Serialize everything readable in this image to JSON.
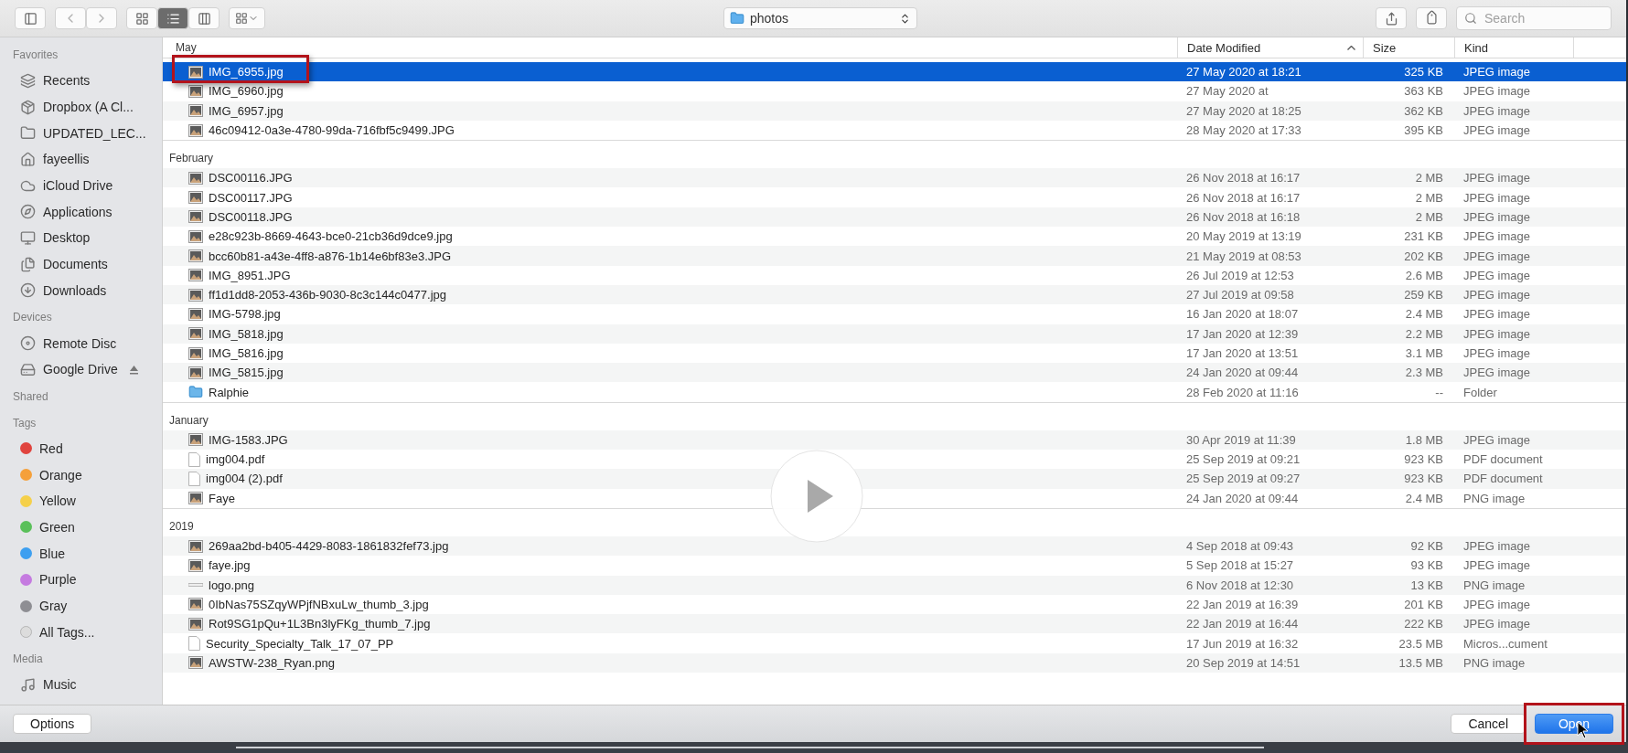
{
  "toolbar": {
    "view_modes": [
      {
        "kind": "icons",
        "selected": false
      },
      {
        "kind": "list",
        "selected": true
      },
      {
        "kind": "columns",
        "selected": false
      }
    ],
    "location": "photos",
    "search": {
      "placeholder": "Search"
    }
  },
  "sidebar": {
    "sections": [
      {
        "title": "Favorites",
        "items": [
          {
            "label": "Recents",
            "kind": "recents"
          },
          {
            "label": "Dropbox (A Cl...",
            "kind": "dropbox"
          },
          {
            "label": "UPDATED_LEC...",
            "kind": "folder"
          },
          {
            "label": "fayeellis",
            "kind": "home"
          },
          {
            "label": "iCloud Drive",
            "kind": "cloud"
          },
          {
            "label": "Applications",
            "kind": "apps"
          },
          {
            "label": "Desktop",
            "kind": "desktop"
          },
          {
            "label": "Documents",
            "kind": "documents"
          },
          {
            "label": "Downloads",
            "kind": "downloads"
          }
        ]
      },
      {
        "title": "Devices",
        "items": [
          {
            "label": "Remote Disc",
            "kind": "disc"
          },
          {
            "label": "Google Drive",
            "kind": "drive"
          }
        ]
      },
      {
        "title": "Shared"
      },
      {
        "title": "Tags",
        "items": [
          {
            "label": "Red",
            "kind": "tag",
            "color": "#e0443e"
          },
          {
            "label": "Orange",
            "kind": "tag",
            "color": "#f5a03a"
          },
          {
            "label": "Yellow",
            "kind": "tag",
            "color": "#f5d04a"
          },
          {
            "label": "Green",
            "kind": "tag",
            "color": "#5ac05a"
          },
          {
            "label": "Blue",
            "kind": "tag",
            "color": "#3d9ff0"
          },
          {
            "label": "Purple",
            "kind": "tag",
            "color": "#c57be0"
          },
          {
            "label": "Gray",
            "kind": "tag",
            "color": "#8e8e93"
          },
          {
            "label": "All Tags...",
            "kind": "all-tags"
          }
        ]
      },
      {
        "title": "Media",
        "items": [
          {
            "label": "Music",
            "kind": "music"
          }
        ]
      }
    ]
  },
  "table": {
    "columns": [
      {
        "label": "Date Modified",
        "sorted": true
      },
      {
        "label": "Size",
        "sorted": false
      },
      {
        "label": "Kind",
        "sorted": false
      }
    ],
    "groups": [
      {
        "title": "May",
        "rows": [
          {
            "name": "IMG_6955.jpg",
            "date": "27 May 2020 at 18:21",
            "size": "325 KB",
            "type": "JPEG image",
            "kind": "photo",
            "selected": true,
            "highlighted": true
          },
          {
            "name": "IMG_6960.jpg",
            "date": "27 May 2020 at",
            "size": "363 KB",
            "type": "JPEG image",
            "kind": "photo",
            "selected": false,
            "highlighted": false
          },
          {
            "name": "IMG_6957.jpg",
            "date": "27 May 2020 at 18:25",
            "size": "362 KB",
            "type": "JPEG image",
            "kind": "photo",
            "selected": false,
            "highlighted": false
          },
          {
            "name": "46c09412-0a3e-4780-99da-716fbf5c9499.JPG",
            "date": "28 May 2020 at 17:33",
            "size": "395 KB",
            "type": "JPEG image",
            "kind": "photo",
            "selected": false,
            "highlighted": false
          }
        ]
      },
      {
        "title": "February",
        "rows": [
          {
            "name": "DSC00116.JPG",
            "date": "26 Nov 2018 at 16:17",
            "size": "2 MB",
            "type": "JPEG image",
            "kind": "photo",
            "selected": false,
            "highlighted": false
          },
          {
            "name": "DSC00117.JPG",
            "date": "26 Nov 2018 at 16:17",
            "size": "2 MB",
            "type": "JPEG image",
            "kind": "photo",
            "selected": false,
            "highlighted": false
          },
          {
            "name": "DSC00118.JPG",
            "date": "26 Nov 2018 at 16:18",
            "size": "2 MB",
            "type": "JPEG image",
            "kind": "photo",
            "selected": false,
            "highlighted": false
          },
          {
            "name": "e28c923b-8669-4643-bce0-21cb36d9dce9.jpg",
            "date": "20 May 2019 at 13:19",
            "size": "231 KB",
            "type": "JPEG image",
            "kind": "photo",
            "selected": false,
            "highlighted": false
          },
          {
            "name": "bcc60b81-a43e-4ff8-a876-1b14e6bf83e3.JPG",
            "date": "21 May 2019 at 08:53",
            "size": "202 KB",
            "type": "JPEG image",
            "kind": "photo",
            "selected": false,
            "highlighted": false
          },
          {
            "name": "IMG_8951.JPG",
            "date": "26 Jul 2019 at 12:53",
            "size": "2.6 MB",
            "type": "JPEG image",
            "kind": "photo",
            "selected": false,
            "highlighted": false
          },
          {
            "name": "ff1d1dd8-2053-436b-9030-8c3c144c0477.jpg",
            "date": "27 Jul 2019 at 09:58",
            "size": "259 KB",
            "type": "JPEG image",
            "kind": "photo",
            "selected": false,
            "highlighted": false
          },
          {
            "name": "IMG-5798.jpg",
            "date": "16 Jan 2020 at 18:07",
            "size": "2.4 MB",
            "type": "JPEG image",
            "kind": "photo",
            "selected": false,
            "highlighted": false
          },
          {
            "name": "IMG_5818.jpg",
            "date": "17 Jan 2020 at 12:39",
            "size": "2.2 MB",
            "type": "JPEG image",
            "kind": "photo",
            "selected": false,
            "highlighted": false
          },
          {
            "name": "IMG_5816.jpg",
            "date": "17 Jan 2020 at 13:51",
            "size": "3.1 MB",
            "type": "JPEG image",
            "kind": "photo",
            "selected": false,
            "highlighted": false
          },
          {
            "name": "IMG_5815.jpg",
            "date": "24 Jan 2020 at 09:44",
            "size": "2.3 MB",
            "type": "JPEG image",
            "kind": "photo",
            "selected": false,
            "highlighted": false
          },
          {
            "name": "Ralphie",
            "date": "28 Feb 2020 at 11:16",
            "size": "--",
            "type": "Folder",
            "kind": "folder",
            "selected": false,
            "highlighted": false
          }
        ]
      },
      {
        "title": "January",
        "rows": [
          {
            "name": "IMG-1583.JPG",
            "date": "30 Apr 2019 at 11:39",
            "size": "1.8 MB",
            "type": "JPEG image",
            "kind": "photo",
            "selected": false,
            "highlighted": false
          },
          {
            "name": "img004.pdf",
            "date": "25 Sep 2019 at 09:21",
            "size": "923 KB",
            "type": "PDF document",
            "kind": "document",
            "selected": false,
            "highlighted": false
          },
          {
            "name": "img004 (2).pdf",
            "date": "25 Sep 2019 at 09:27",
            "size": "923 KB",
            "type": "PDF document",
            "kind": "document",
            "selected": false,
            "highlighted": false
          },
          {
            "name": "Faye",
            "date": "24 Jan 2020 at 09:44",
            "size": "2.4 MB",
            "type": "PNG image",
            "kind": "photo",
            "selected": false,
            "highlighted": false
          }
        ]
      },
      {
        "title": "2019",
        "rows": [
          {
            "name": "269aa2bd-b405-4429-8083-1861832fef73.jpg",
            "date": "4 Sep 2018 at 09:43",
            "size": "92 KB",
            "type": "JPEG image",
            "kind": "photo",
            "selected": false,
            "highlighted": false
          },
          {
            "name": "faye.jpg",
            "date": "5 Sep 2018 at 15:27",
            "size": "93 KB",
            "type": "JPEG image",
            "kind": "photo",
            "selected": false,
            "highlighted": false
          },
          {
            "name": "logo.png",
            "date": "6 Nov 2018 at 12:30",
            "size": "13 KB",
            "type": "PNG image",
            "kind": "strip",
            "selected": false,
            "highlighted": false
          },
          {
            "name": "0IbNas75SZqyWPjfNBxuLw_thumb_3.jpg",
            "date": "22 Jan 2019 at 16:39",
            "size": "201 KB",
            "type": "JPEG image",
            "kind": "photo",
            "selected": false,
            "highlighted": false
          },
          {
            "name": "Rot9SG1pQu+1L3Bn3lyFKg_thumb_7.jpg",
            "date": "22 Jan 2019 at 16:44",
            "size": "222 KB",
            "type": "JPEG image",
            "kind": "photo",
            "selected": false,
            "highlighted": false
          },
          {
            "name": "Security_Specialty_Talk_17_07_PP",
            "date": "17 Jun 2019 at 16:32",
            "size": "23.5 MB",
            "type": "Micros...cument",
            "kind": "document",
            "selected": false,
            "highlighted": false
          },
          {
            "name": "AWSTW-238_Ryan.png",
            "date": "20 Sep 2019 at 14:51",
            "size": "13.5 MB",
            "type": "PNG image",
            "kind": "photo",
            "selected": false,
            "highlighted": false
          }
        ]
      }
    ]
  },
  "buttons": [
    {
      "label": "Options",
      "kind": "plain",
      "highlighted": false
    },
    {
      "label": "Cancel",
      "kind": "plain",
      "highlighted": false
    },
    {
      "label": "Open",
      "kind": "default",
      "highlighted": true
    }
  ]
}
